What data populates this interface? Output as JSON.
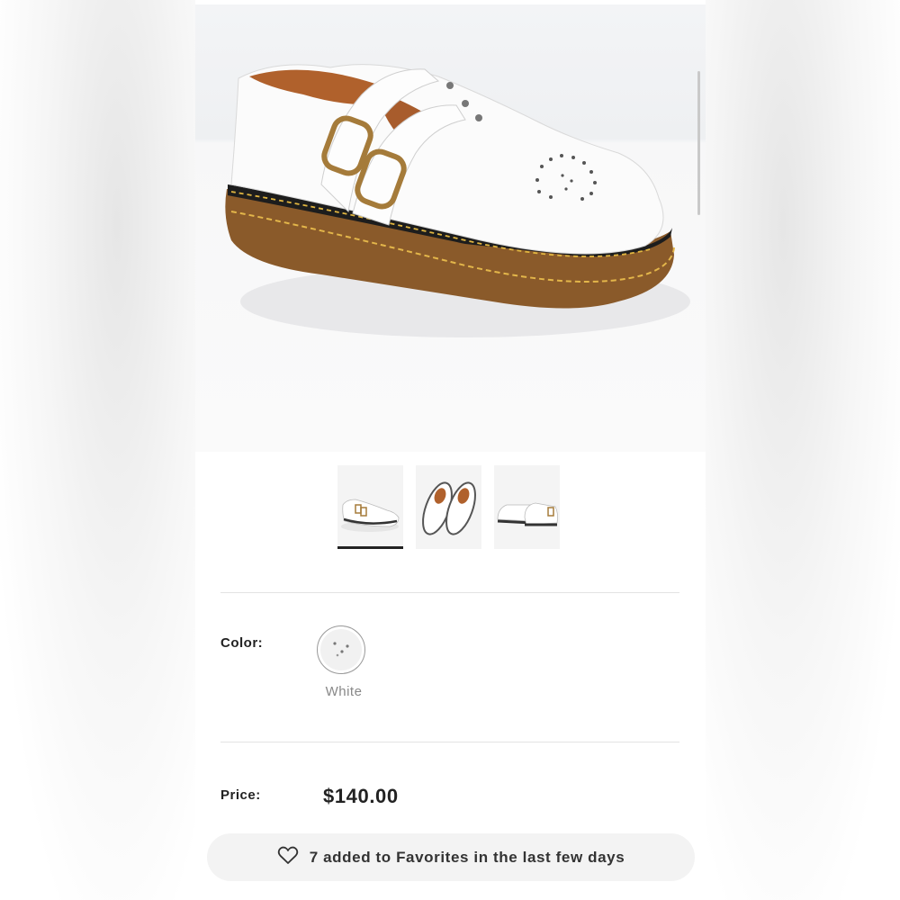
{
  "product": {
    "main_image": "white-mary-jane-shoe-photo",
    "thumbnails": [
      {
        "name": "thumbnail-side-view",
        "active": true
      },
      {
        "name": "thumbnail-pair-top-view",
        "active": false
      },
      {
        "name": "thumbnail-pair-back-view",
        "active": false
      }
    ]
  },
  "color": {
    "label": "Color:",
    "selected": "White",
    "swatch_color": "#f1f1f1"
  },
  "price": {
    "label": "Price:",
    "value": "$140.00"
  },
  "favorites": {
    "icon": "heart-outline-icon",
    "text": "7 added to Favorites in the last few days"
  },
  "colors": {
    "text_primary": "#222222",
    "text_muted": "#888888",
    "pill_bg": "#f3f3f3"
  }
}
